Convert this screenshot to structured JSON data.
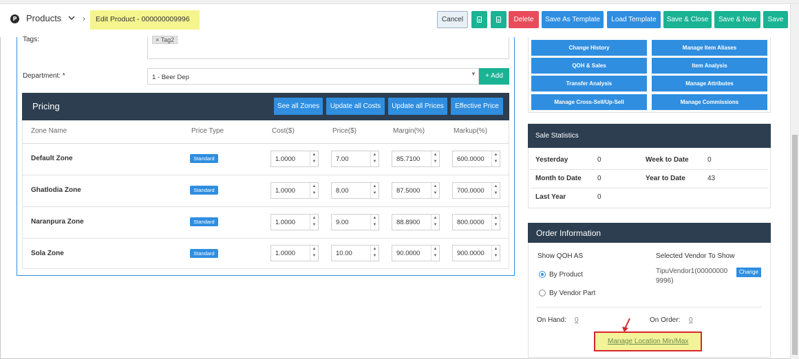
{
  "header": {
    "logo_letter": "P",
    "module": "Products",
    "breadcrumb": "Edit Product - 000000009996",
    "buttons": {
      "cancel": "Cancel",
      "delete": "Delete",
      "save_as_template": "Save As Template",
      "load_template": "Load Template",
      "save_close": "Save & Close",
      "save_new": "Save & New",
      "save": "Save"
    },
    "icons": [
      "chevron-down-icon",
      "document-icon",
      "document-icon"
    ]
  },
  "form": {
    "tags_label": "Tags:",
    "tag_chip": "× Tag2",
    "department_label": "Department: *",
    "department_value": "1 - Beer Dep",
    "add_label": "+ Add"
  },
  "pricing": {
    "title": "Pricing",
    "buttons": [
      "See all Zones",
      "Update all Costs",
      "Update all Prices",
      "Effective Price"
    ],
    "columns": [
      "Zone Name",
      "Price Type",
      "Cost($)",
      "Price($)",
      "Margin(%)",
      "Markup(%)"
    ],
    "rows": [
      {
        "zone": "Default Zone",
        "type": "Standard",
        "cost": "1.0000",
        "price": "7.00",
        "margin": "85.7100",
        "markup": "600.0000"
      },
      {
        "zone": "Ghatlodia Zone",
        "type": "Standard",
        "cost": "1.0000",
        "price": "8.00",
        "margin": "87.5000",
        "markup": "700.0000"
      },
      {
        "zone": "Naranpura Zone",
        "type": "Standard",
        "cost": "1.0000",
        "price": "9.00",
        "margin": "88.8900",
        "markup": "800.0000"
      },
      {
        "zone": "Sola Zone",
        "type": "Standard",
        "cost": "1.0000",
        "price": "10.00",
        "margin": "90.0000",
        "markup": "900.0000"
      }
    ]
  },
  "actions": {
    "col1": [
      "Change History",
      "QOH & Sales",
      "Transfer Analysis",
      "Manage Cross-Sell/Up-Sell"
    ],
    "col2": [
      "Manage Item Aliases",
      "Item Analysis",
      "Manage Attributes",
      "Manage Commissions"
    ]
  },
  "sale_statistics": {
    "title": "Sale Statistics",
    "yesterday_label": "Yesterday",
    "yesterday": "0",
    "week_label": "Week to Date",
    "week": "0",
    "month_label": "Month to Date",
    "month": "0",
    "year_label": "Year to Date",
    "year": "43",
    "last_year_label": "Last Year",
    "last_year": "0"
  },
  "order_info": {
    "title": "Order Information",
    "show_qoh_label": "Show QOH AS",
    "vendor_label": "Selected Vendor To Show",
    "by_product": "By Product",
    "by_vendor_part": "By Vendor Part",
    "vendor_line1": "TipuVendor1(00000000",
    "vendor_line2": "9996)",
    "change_label": "Change",
    "on_hand_label": "On Hand:",
    "on_hand": "0",
    "on_order_label": "On Order:",
    "on_order": "0",
    "manage_link": "Manage Location Min/Max"
  },
  "colors": {
    "navy": "#2c3e50",
    "blue": "#2f8ee0",
    "green": "#1ab394",
    "red": "#e84c5a",
    "highlight": "#f5f58e",
    "annotation_red": "#d6262b"
  }
}
